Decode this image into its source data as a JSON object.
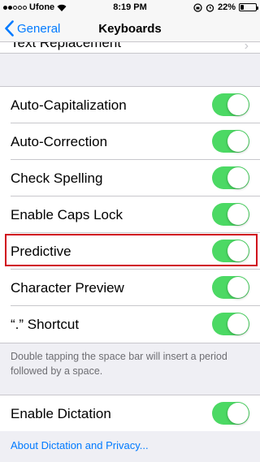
{
  "status_bar": {
    "carrier": "Ufone",
    "time": "8:19 PM",
    "battery": "22%",
    "battery_level": 0.22
  },
  "nav": {
    "back_label": "General",
    "title": "Keyboards"
  },
  "cropped_row": {
    "label": "Text Replacement"
  },
  "toggles": [
    {
      "label": "Auto-Capitalization",
      "on": true
    },
    {
      "label": "Auto-Correction",
      "on": true
    },
    {
      "label": "Check Spelling",
      "on": true
    },
    {
      "label": "Enable Caps Lock",
      "on": true
    },
    {
      "label": "Predictive",
      "on": true
    },
    {
      "label": "Character Preview",
      "on": true
    },
    {
      "label": "“.” Shortcut",
      "on": true
    }
  ],
  "shortcut_note": "Double tapping the space bar will insert a period followed by a space.",
  "dictation": {
    "label": "Enable Dictation",
    "on": true
  },
  "about_link": "About Dictation and Privacy...",
  "colors": {
    "accent": "#007aff",
    "toggle_on": "#4cd964",
    "highlight": "#d0021b",
    "background": "#efeff4"
  }
}
